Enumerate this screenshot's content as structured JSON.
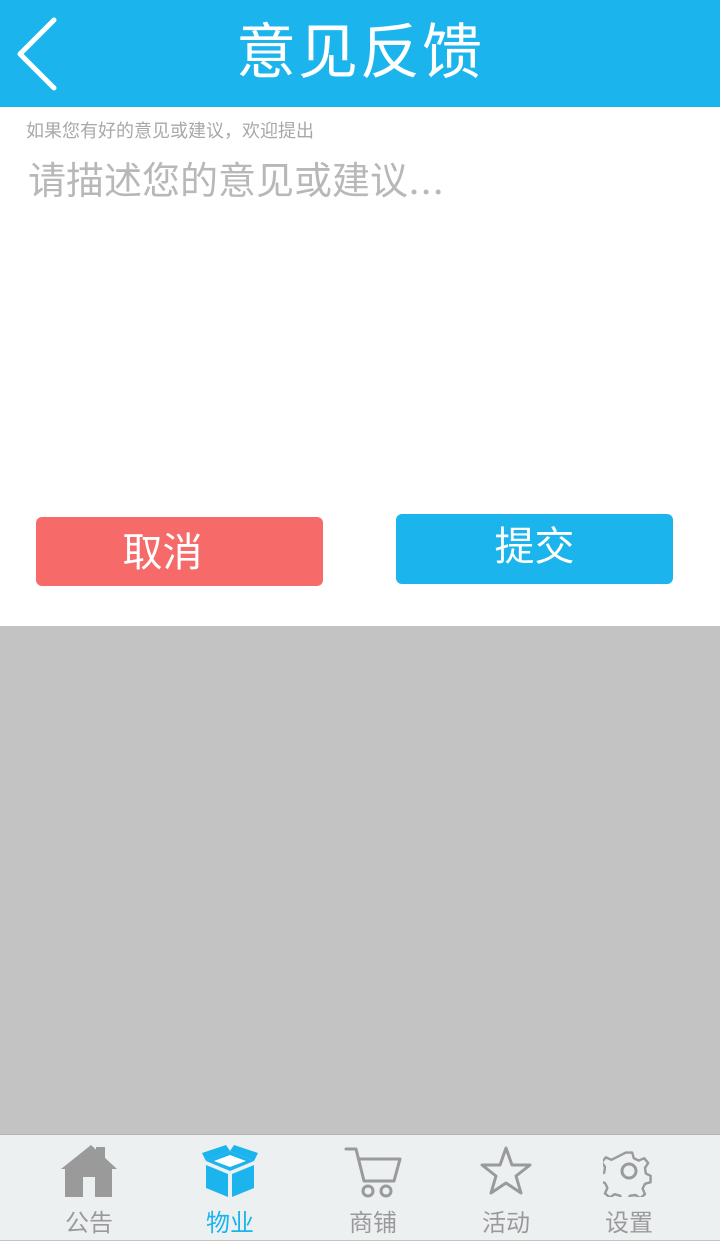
{
  "header": {
    "title": "意见反馈",
    "back_icon": "chevron-left-icon",
    "background": "#1bb4ec"
  },
  "feedback": {
    "hint": "如果您有好的意见或建议，欢迎提出",
    "placeholder": "请描述您的意见或建议...",
    "value": ""
  },
  "actions": {
    "cancel_label": "取消",
    "submit_label": "提交",
    "cancel_color": "#f76a6a",
    "submit_color": "#1bb4ec"
  },
  "tabbar": {
    "items": [
      {
        "label": "公告",
        "icon": "home-icon",
        "active": false
      },
      {
        "label": "物业",
        "icon": "box-icon",
        "active": true
      },
      {
        "label": "商铺",
        "icon": "cart-icon",
        "active": false
      },
      {
        "label": "活动",
        "icon": "star-icon",
        "active": false
      },
      {
        "label": "设置",
        "icon": "gear-icon",
        "active": false
      }
    ],
    "active_color": "#1bb4ec",
    "inactive_color": "#9a9a9a"
  }
}
